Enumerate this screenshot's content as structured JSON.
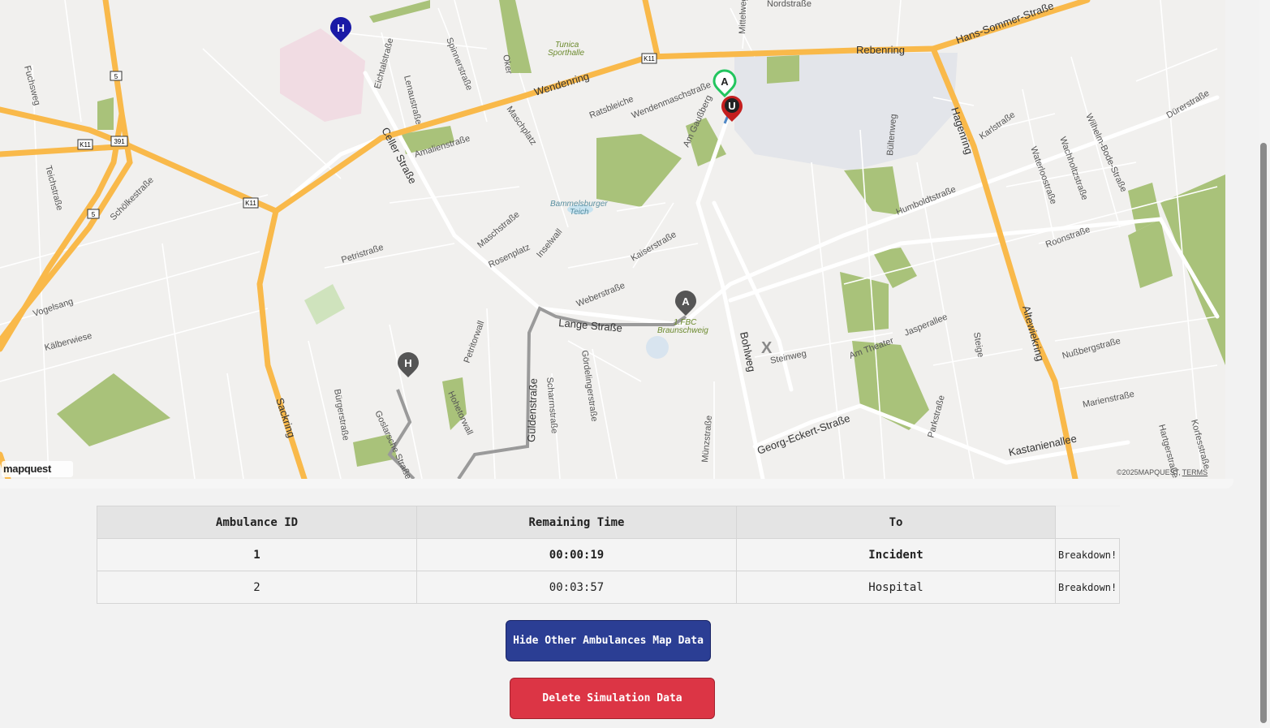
{
  "map": {
    "streets": [
      "Nordstraße",
      "Rebenring",
      "Hans-Sommer-Straße",
      "Wendenring",
      "Wendenmaschstraße",
      "Ratsbleiche",
      "Celler Straße",
      "Amalienstraße",
      "Schölkestraße",
      "Petristraße",
      "Vogelsang",
      "Kälberwiese",
      "Lange Straße",
      "Weberstraße",
      "Kaiserstraße",
      "Humboldtstraße",
      "Jasperallee",
      "Nußbergstraße",
      "Marienstraße",
      "Kastanienallee",
      "Georg-Eckert-Straße",
      "Steinweg",
      "Bohlweg",
      "Hagenring",
      "Altewiekring",
      "Sackring",
      "Güldenstraße",
      "Maschstraße",
      "Inselwall",
      "Petritorwall",
      "Gördelingerstraße",
      "Scharrnstraße",
      "Karlstraße",
      "Roonstraße",
      "Wachholtzstraße",
      "Waterloostraße",
      "Wilhelm-Bode-Straße",
      "Dürerstraße",
      "Lenaustraße",
      "Eichtalstraße",
      "Spinnerstraße",
      "Maschplatz",
      "Fuchsweg",
      "Teichstraße",
      "Bültenweg",
      "Parkstraße",
      "Steige",
      "Am Theater",
      "Münzstraße",
      "Bürgerstraße",
      "Goslarsche Straße",
      "Hohetorwall",
      "Mittelweg",
      "Hartgerstraße",
      "Korfesstraße",
      "Am Gaußberg",
      "Rosenplatz",
      "Oker"
    ],
    "road_badges": [
      "K11",
      "391",
      "5"
    ],
    "places": [
      "Tunica Sporthalle",
      "Bammelsburger Teich",
      "1. FBC Braunschweig"
    ],
    "pins": [
      {
        "letter": "H",
        "color": "#1a1aa6",
        "label": "hospital-pin-blue"
      },
      {
        "letter": "A",
        "color": "#22c55e",
        "label": "ambulance-pin-active"
      },
      {
        "letter": "U",
        "color": "#c41e1e",
        "label": "incident-pin"
      },
      {
        "letter": "A",
        "color": "#555555",
        "label": "ambulance-pin-other"
      },
      {
        "letter": "H",
        "color": "#555555",
        "label": "hospital-pin-grey"
      }
    ],
    "x_mark": "X",
    "logo": "mapquest",
    "copyright": "©2025MAPQUEST,",
    "terms": "TERMS",
    "colors": {
      "highway": "#f9b94a",
      "route": "#9a9a9a",
      "park": "#a9c27a",
      "water": "#c7e3f0",
      "built": "#e3e5ea",
      "hospital_area": "#f1dce3"
    }
  },
  "table": {
    "headers": [
      "Ambulance ID",
      "Remaining Time",
      "To"
    ],
    "rows": [
      {
        "id": "1",
        "time": "00:00:19",
        "to": "Incident",
        "action": "Breakdown!",
        "bold": true
      },
      {
        "id": "2",
        "time": "00:03:57",
        "to": "Hospital",
        "action": "Breakdown!",
        "bold": false
      }
    ]
  },
  "buttons": {
    "hide": "Hide Other Ambulances Map Data",
    "delete": "Delete Simulation Data"
  }
}
